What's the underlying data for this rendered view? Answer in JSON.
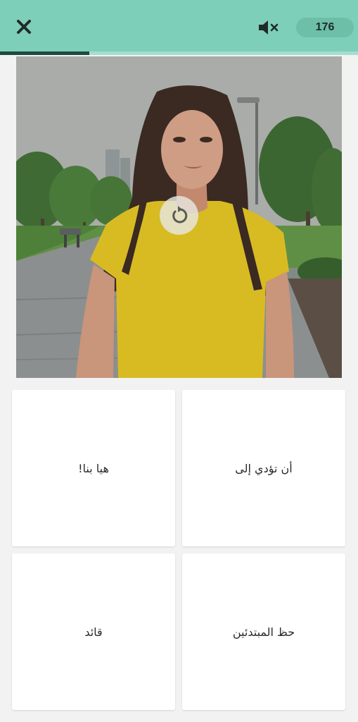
{
  "header": {
    "close_icon": "close-icon",
    "mute_icon": "speaker-muted-icon",
    "score": "176",
    "progress_fraction": 0.25,
    "colors": {
      "bar": "#7ecfb9",
      "progress": "#1d4b40",
      "pill": "#6dbfa8"
    }
  },
  "video": {
    "replay_icon": "replay-icon"
  },
  "choices": [
    {
      "label": "أن تؤدي إلى"
    },
    {
      "label": "هيا بنا!"
    },
    {
      "label": "حظ المبتدئين"
    },
    {
      "label": "قائد"
    }
  ]
}
